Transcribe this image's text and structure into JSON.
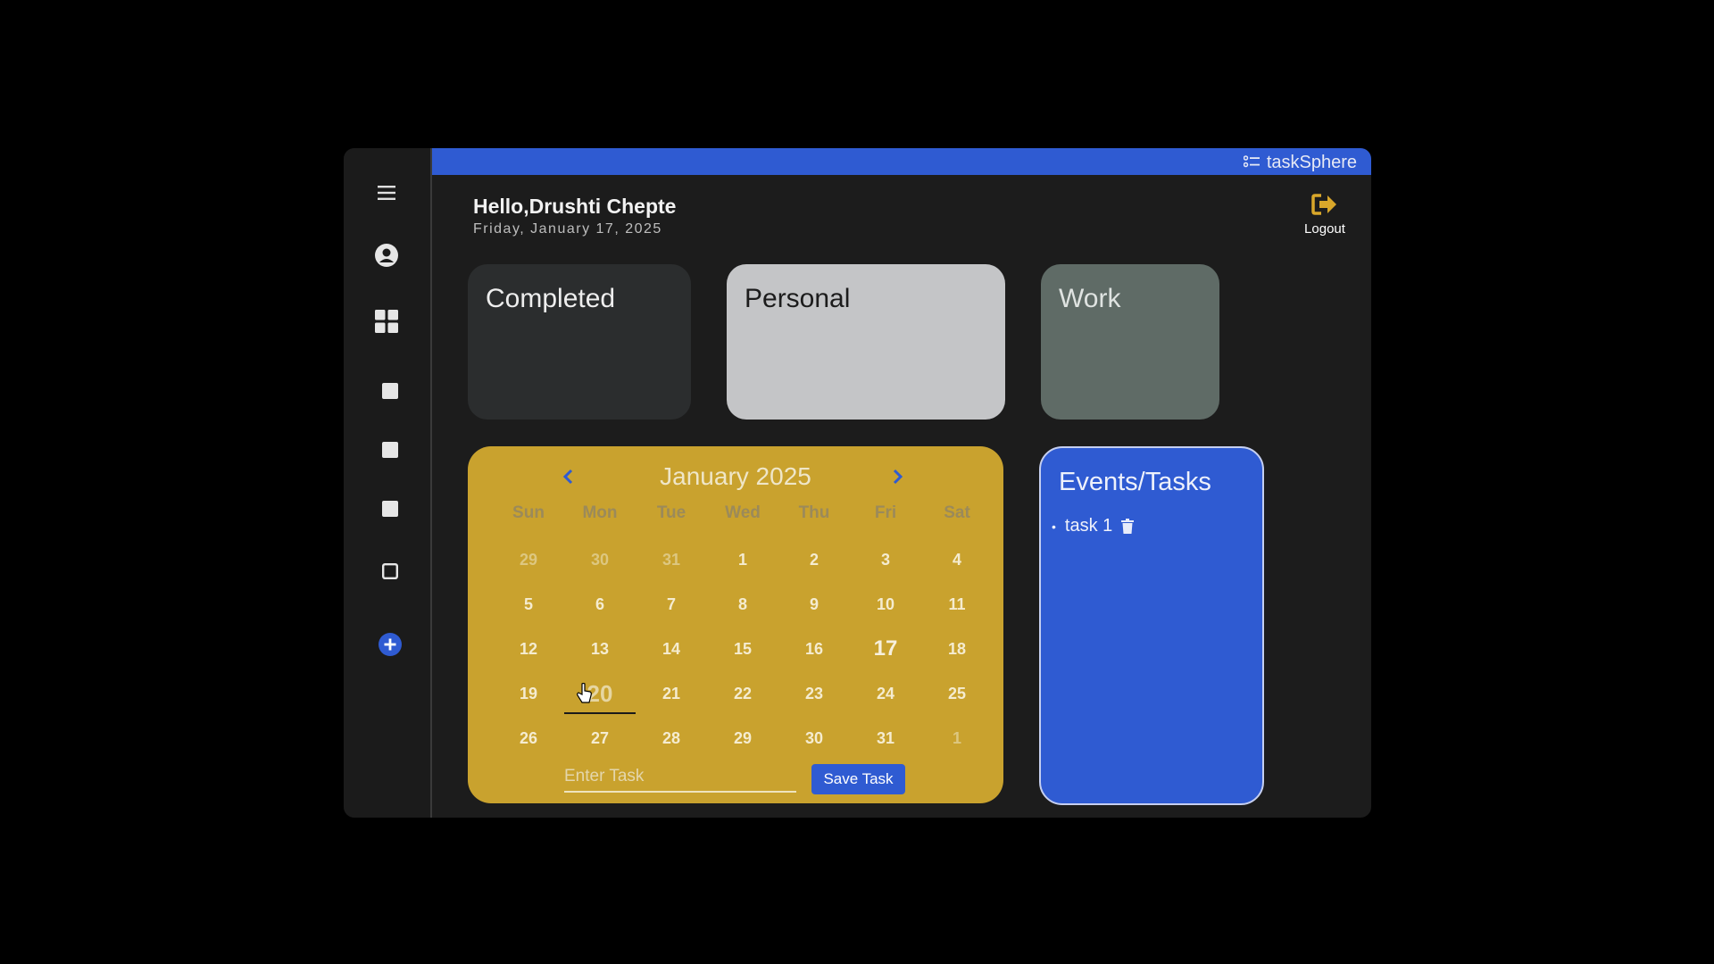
{
  "header": {
    "brand": "taskSphere",
    "greeting": "Hello,Drushti Chepte",
    "date": "Friday, January 17, 2025",
    "logout_label": "Logout"
  },
  "sidebar": {
    "items": [
      {
        "icon": "menu-icon"
      },
      {
        "icon": "user-circle-icon"
      },
      {
        "icon": "grid-dashboard-icon"
      },
      {
        "icon": "square-filled-icon"
      },
      {
        "icon": "square-filled-icon"
      },
      {
        "icon": "square-filled-icon"
      },
      {
        "icon": "square-outline-icon"
      },
      {
        "icon": "add-circle-icon"
      }
    ]
  },
  "cards": [
    {
      "label": "Completed",
      "color": "#2b2d2e"
    },
    {
      "label": "Personal",
      "color": "#c4c5c7"
    },
    {
      "label": "Work",
      "color": "#5f6b66"
    }
  ],
  "calendar": {
    "title": "January 2025",
    "weekdays": [
      "Sun",
      "Mon",
      "Tue",
      "Wed",
      "Thu",
      "Fri",
      "Sat"
    ],
    "weeks": [
      [
        "29",
        "30",
        "31",
        "1",
        "2",
        "3",
        "4"
      ],
      [
        "5",
        "6",
        "7",
        "8",
        "9",
        "10",
        "11"
      ],
      [
        "12",
        "13",
        "14",
        "15",
        "16",
        "17",
        "18"
      ],
      [
        "19",
        "20",
        "21",
        "22",
        "23",
        "24",
        "25"
      ],
      [
        "26",
        "27",
        "28",
        "29",
        "30",
        "31",
        "1"
      ]
    ],
    "today": "17",
    "selected": "20",
    "input_placeholder": "Enter Task",
    "save_label": "Save Task"
  },
  "events": {
    "title": "Events/Tasks",
    "items": [
      "task 1"
    ]
  },
  "colors": {
    "accent": "#2f5bd2",
    "calendar_bg": "#c9a22e",
    "logout_icon": "#d9a72a"
  }
}
